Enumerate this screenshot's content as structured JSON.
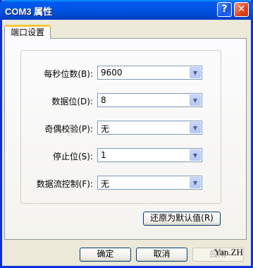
{
  "window": {
    "title": "COM3 属性",
    "help_glyph": "?",
    "close_glyph": "✕"
  },
  "tab": {
    "label": "端口设置"
  },
  "fields": [
    {
      "label": "每秒位数(B):",
      "value": "9600"
    },
    {
      "label": "数据位(D):",
      "value": "8"
    },
    {
      "label": "奇偶校验(P):",
      "value": "无"
    },
    {
      "label": "停止位(S):",
      "value": "1"
    },
    {
      "label": "数据流控制(F):",
      "value": "无"
    }
  ],
  "restore_defaults_label": "还原为默认值(R)",
  "footer": {
    "ok_label": "确定",
    "cancel_label": "取消",
    "apply_label": "应用"
  },
  "watermark": "Yan.ZH",
  "icons": {
    "dropdown": "chevron-down-icon"
  }
}
